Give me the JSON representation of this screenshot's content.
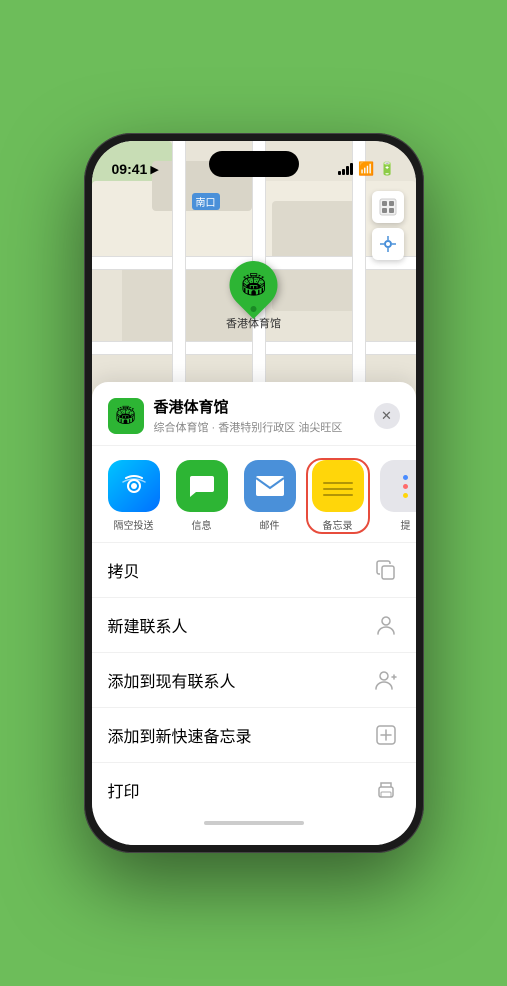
{
  "status_bar": {
    "time": "09:41",
    "location_arrow": "▶"
  },
  "map": {
    "label_south_entrance": "南口",
    "location_name": "香港体育馆",
    "pin_emoji": "🏟"
  },
  "location_card": {
    "name": "香港体育馆",
    "subtitle": "综合体育馆 · 香港特别行政区 油尖旺区",
    "close_label": "✕"
  },
  "share_items": [
    {
      "id": "airdrop",
      "label": "隔空投送",
      "emoji": "📡"
    },
    {
      "id": "messages",
      "label": "信息",
      "emoji": "💬"
    },
    {
      "id": "mail",
      "label": "邮件",
      "emoji": "✉️"
    },
    {
      "id": "notes",
      "label": "备忘录",
      "emoji": "📝"
    },
    {
      "id": "more",
      "label": "提",
      "emoji": "···"
    }
  ],
  "actions": [
    {
      "id": "copy",
      "label": "拷贝",
      "icon": "⎘"
    },
    {
      "id": "new-contact",
      "label": "新建联系人",
      "icon": "👤"
    },
    {
      "id": "add-existing",
      "label": "添加到现有联系人",
      "icon": "👤+"
    },
    {
      "id": "add-note",
      "label": "添加到新快速备忘录",
      "icon": "⊞"
    },
    {
      "id": "print",
      "label": "打印",
      "icon": "🖨"
    }
  ],
  "home_indicator": "—"
}
